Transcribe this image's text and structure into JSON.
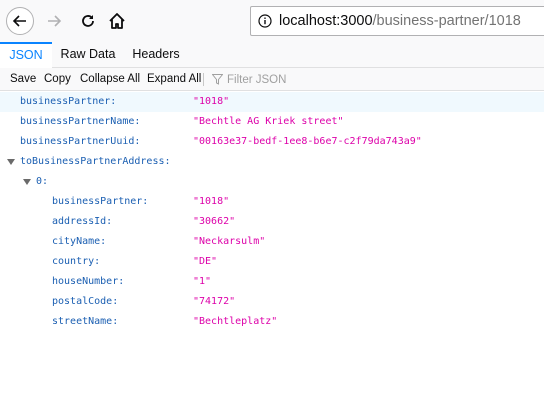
{
  "browser": {
    "url_host": "localhost:3000",
    "url_path": "/business-partner/1018"
  },
  "tabs": [
    {
      "label": "JSON"
    },
    {
      "label": "Raw Data"
    },
    {
      "label": "Headers"
    }
  ],
  "toolbar": {
    "save": "Save",
    "copy": "Copy",
    "collapse_all": "Collapse All",
    "expand_all": "Expand All",
    "filter_placeholder": "Filter JSON"
  },
  "json": {
    "rows": [
      {
        "key": "businessPartner:",
        "value": "\"1018\""
      },
      {
        "key": "businessPartnerName:",
        "value": "\"Bechtle AG Kriek street\""
      },
      {
        "key": "businessPartnerUuid:",
        "value": "\"00163e37-bedf-1ee8-b6e7-c2f79da743a9\""
      },
      {
        "key": "toBusinessPartnerAddress:",
        "value": ""
      },
      {
        "key": "0:",
        "value": ""
      },
      {
        "key": "businessPartner:",
        "value": "\"1018\""
      },
      {
        "key": "addressId:",
        "value": "\"30662\""
      },
      {
        "key": "cityName:",
        "value": "\"Neckarsulm\""
      },
      {
        "key": "country:",
        "value": "\"DE\""
      },
      {
        "key": "houseNumber:",
        "value": "\"1\""
      },
      {
        "key": "postalCode:",
        "value": "\"74172\""
      },
      {
        "key": "streetName:",
        "value": "\"Bechtleplatz\""
      }
    ]
  },
  "colors": {
    "key": "#1b5fb2",
    "string": "#dd00a9",
    "accent": "#0a84ff"
  }
}
